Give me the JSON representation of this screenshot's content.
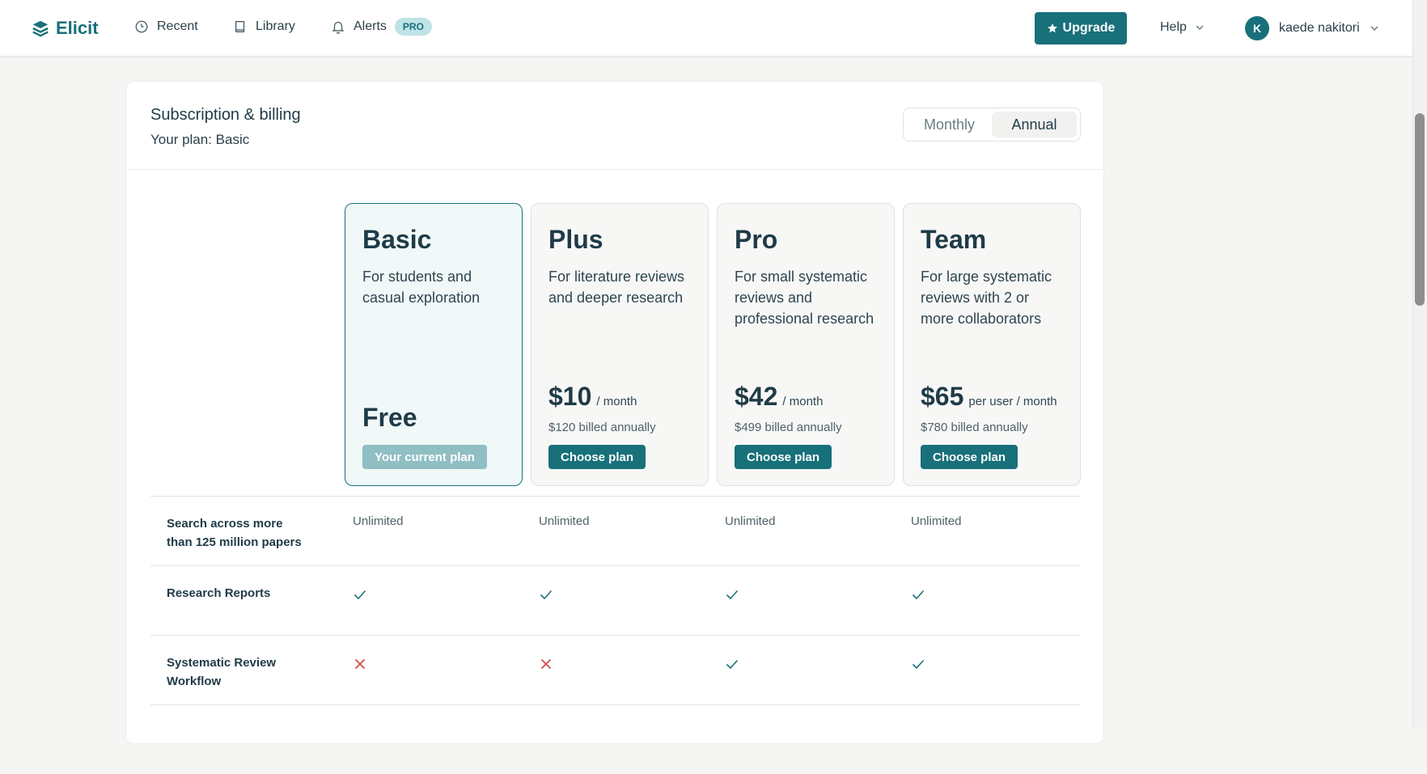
{
  "app": {
    "name": "Elicit",
    "brand_color": "#17707a"
  },
  "nav": {
    "recent": "Recent",
    "library": "Library",
    "alerts": "Alerts",
    "alerts_badge": "PRO"
  },
  "header": {
    "upgrade": "Upgrade",
    "help": "Help",
    "user_initial": "K",
    "user_name": "kaede nakitori"
  },
  "billing": {
    "title": "Subscription & billing",
    "current_plan": "Your plan: Basic",
    "toggle": {
      "monthly": "Monthly",
      "annual": "Annual",
      "selected": "Annual"
    }
  },
  "plans": [
    {
      "name": "Basic",
      "desc": "For students and casual exploration",
      "price": "Free",
      "unit": "",
      "billed": "",
      "button": "Your current plan",
      "current": true
    },
    {
      "name": "Plus",
      "desc": "For literature reviews and deeper research",
      "price": "$10",
      "unit": "/ month",
      "billed": "$120 billed annually",
      "button": "Choose plan",
      "current": false
    },
    {
      "name": "Pro",
      "desc": "For small systematic reviews and professional research",
      "price": "$42",
      "unit": "/ month",
      "billed": "$499 billed annually",
      "button": "Choose plan",
      "current": false
    },
    {
      "name": "Team",
      "desc": "For large systematic reviews with 2 or more collaborators",
      "price": "$65",
      "unit": "per user / month",
      "billed": "$780 billed annually",
      "button": "Choose plan",
      "current": false
    }
  ],
  "features": [
    {
      "label": "Search across more than 125 million papers",
      "values": [
        "Unlimited",
        "Unlimited",
        "Unlimited",
        "Unlimited"
      ]
    },
    {
      "label": "Research Reports",
      "values": [
        "check",
        "check",
        "check",
        "check"
      ]
    },
    {
      "label": "Systematic Review Workflow",
      "values": [
        "cross",
        "cross",
        "check",
        "check"
      ]
    }
  ]
}
